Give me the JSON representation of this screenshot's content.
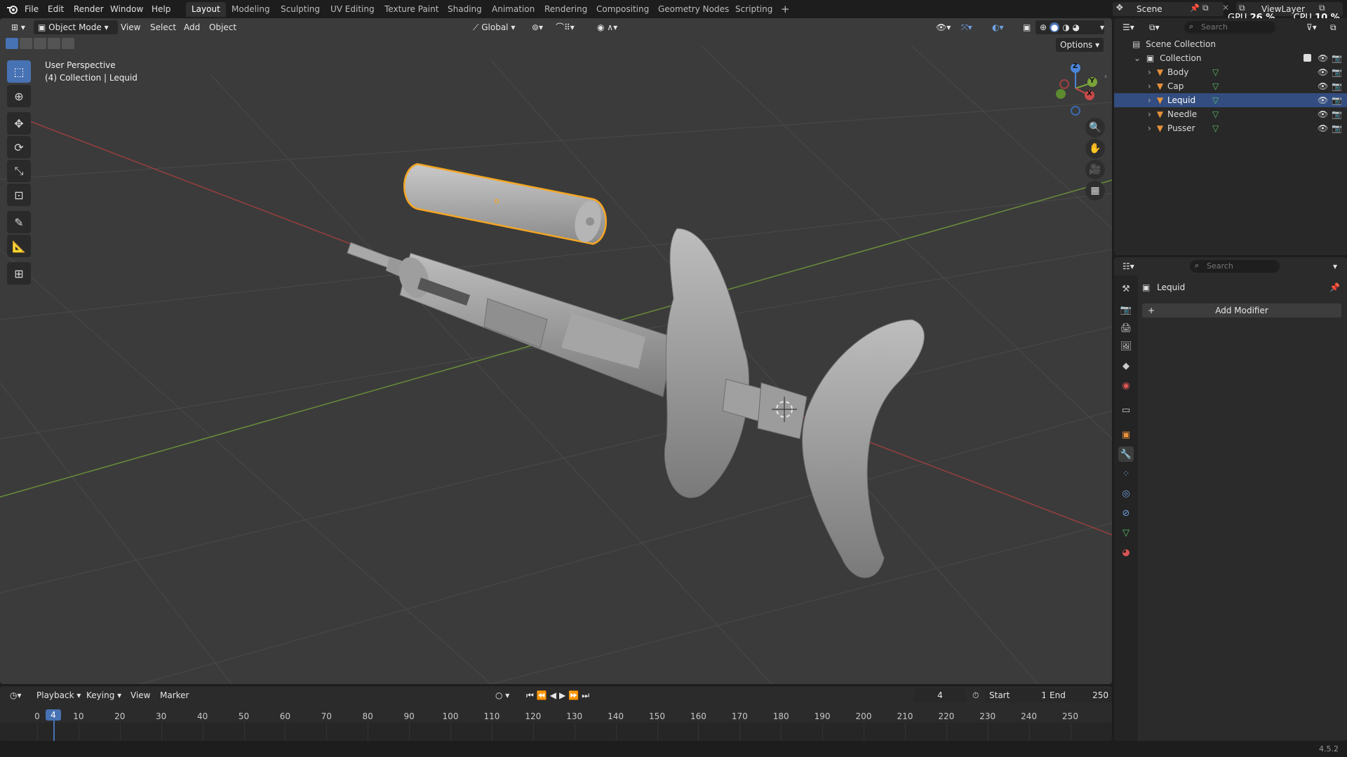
{
  "menubar": {
    "menus": [
      "File",
      "Edit",
      "Render",
      "Window",
      "Help"
    ],
    "workspaces": [
      "Layout",
      "Modeling",
      "Sculpting",
      "UV Editing",
      "Texture Paint",
      "Shading",
      "Animation",
      "Rendering",
      "Compositing",
      "Geometry Nodes",
      "Scripting"
    ],
    "active_workspace": "Layout",
    "scene_label": "Scene",
    "view_layer_label": "ViewLayer",
    "gpu_label": "GPU",
    "gpu_value": "26 %",
    "cpu_label": "CPU",
    "cpu_value": "10 %"
  },
  "viewport": {
    "mode": "Object Mode",
    "menus": [
      "View",
      "Select",
      "Add",
      "Object"
    ],
    "orientation": "Global",
    "options_label": "Options",
    "overlay_title": "User Perspective",
    "overlay_subtitle": "(4) Collection | Lequid",
    "gizmo_axes": [
      "Z",
      "Y",
      "X"
    ]
  },
  "outliner": {
    "search_placeholder": "Search",
    "scene_collection": "Scene Collection",
    "collection": "Collection",
    "objects": [
      {
        "name": "Body",
        "selected": false
      },
      {
        "name": "Cap",
        "selected": false
      },
      {
        "name": "Lequid",
        "selected": true
      },
      {
        "name": "Needle",
        "selected": false
      },
      {
        "name": "Pusser",
        "selected": false
      }
    ]
  },
  "properties": {
    "search_placeholder": "Search",
    "object_name": "Lequid",
    "add_modifier_label": "Add Modifier"
  },
  "timeline": {
    "menus": [
      "Playback",
      "Keying",
      "View",
      "Marker"
    ],
    "current_frame": "4",
    "start_label": "Start",
    "start_value": "1",
    "end_label": "End",
    "end_value": "250",
    "ticks": [
      "0",
      "10",
      "20",
      "30",
      "40",
      "50",
      "60",
      "70",
      "80",
      "90",
      "100",
      "110",
      "120",
      "130",
      "140",
      "150",
      "160",
      "170",
      "180",
      "190",
      "200",
      "210",
      "220",
      "230",
      "240",
      "250"
    ]
  },
  "status": {
    "version": "4.5.2"
  },
  "colors": {
    "accent": "#4772b3",
    "selection_outline": "#f5a623",
    "x_axis": "#c84a4a",
    "y_axis": "#7aa43a",
    "z_axis": "#4a84d8"
  }
}
